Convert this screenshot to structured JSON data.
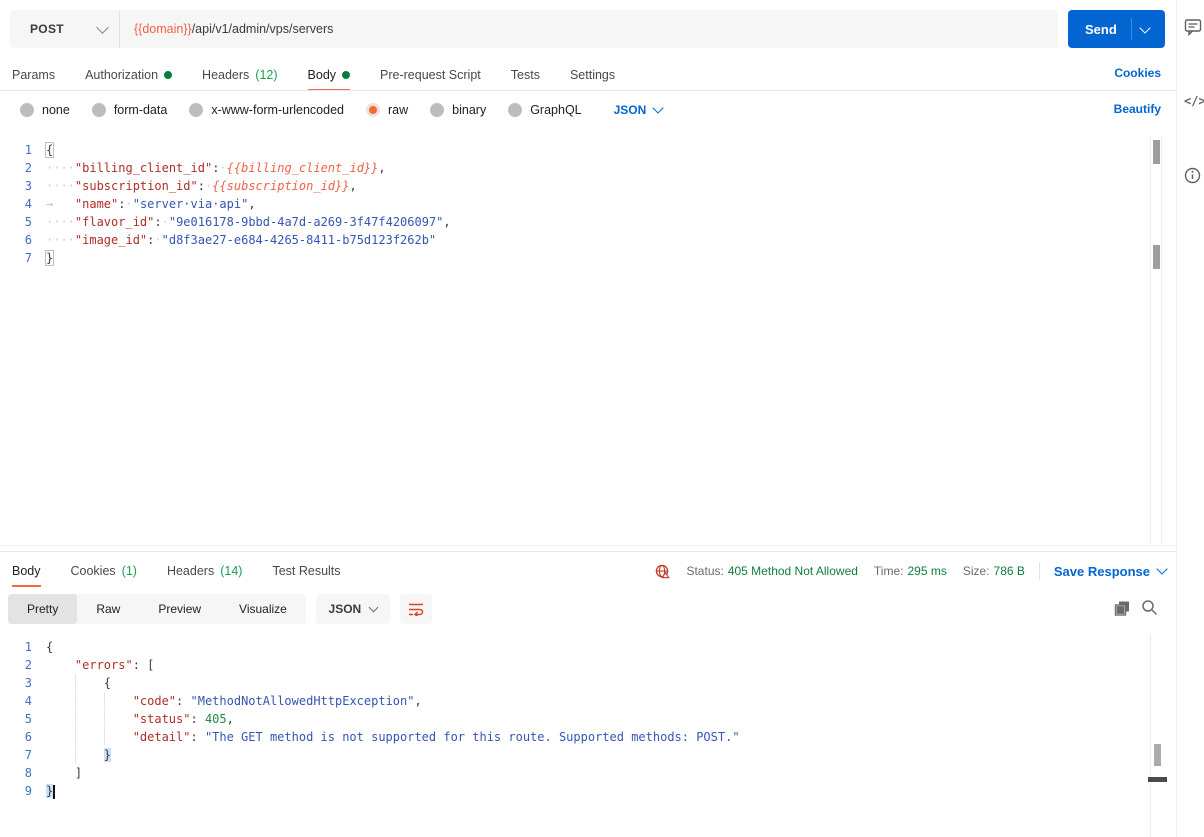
{
  "colors": {
    "accent_orange": "#F26B3A",
    "link_blue": "#0265D2",
    "success_green": "#0F7E3C",
    "error_red": "#C43C2E"
  },
  "request_bar": {
    "method": "POST",
    "url_variable": "{{domain}}",
    "url_path": "/api/v1/admin/vps/servers",
    "send_label": "Send"
  },
  "request_tabs": {
    "items": [
      {
        "label": "Params",
        "active": false
      },
      {
        "label": "Authorization",
        "dot": true,
        "active": false
      },
      {
        "label": "Headers",
        "badge": "(12)",
        "active": false
      },
      {
        "label": "Body",
        "dot": true,
        "active": true
      },
      {
        "label": "Pre-request Script",
        "active": false
      },
      {
        "label": "Tests",
        "active": false
      },
      {
        "label": "Settings",
        "active": false
      }
    ],
    "cookies_link": "Cookies"
  },
  "body_type_bar": {
    "options": [
      {
        "label": "none",
        "selected": false
      },
      {
        "label": "form-data",
        "selected": false
      },
      {
        "label": "x-www-form-urlencoded",
        "selected": false
      },
      {
        "label": "raw",
        "selected": true
      },
      {
        "label": "binary",
        "selected": false
      },
      {
        "label": "GraphQL",
        "selected": false
      }
    ],
    "language": "JSON",
    "beautify_label": "Beautify"
  },
  "request_editor": {
    "raw_text": [
      "{",
      "    \"billing_client_id\": {{billing_client_id}},",
      "    \"subscription_id\": {{subscription_id}},",
      "\t\"name\": \"server via api\",",
      "    \"flavor_id\": \"9e016178-9bbd-4a7d-a269-3f47f4206097\",",
      "    \"image_id\": \"d8f3ae27-e684-4265-8411-b75d123f262b\"",
      "}"
    ],
    "lines": [
      {
        "no": 1,
        "tokens": [
          {
            "t": "brace-box",
            "v": "{"
          }
        ]
      },
      {
        "no": 2,
        "tokens": [
          {
            "t": "ws",
            "v": "····"
          },
          {
            "t": "key",
            "v": "\"billing_client_id\""
          },
          {
            "t": "punc",
            "v": ":"
          },
          {
            "t": "ws",
            "v": "·"
          },
          {
            "t": "var",
            "v": "{{billing_client_id}}"
          },
          {
            "t": "punc",
            "v": ","
          }
        ]
      },
      {
        "no": 3,
        "tokens": [
          {
            "t": "ws",
            "v": "····"
          },
          {
            "t": "key",
            "v": "\"subscription_id\""
          },
          {
            "t": "punc",
            "v": ":"
          },
          {
            "t": "ws",
            "v": "·"
          },
          {
            "t": "var",
            "v": "{{subscription_id}}"
          },
          {
            "t": "punc",
            "v": ","
          }
        ]
      },
      {
        "no": 4,
        "tokens": [
          {
            "t": "tab",
            "v": "→"
          },
          {
            "t": "key",
            "v": "\"name\""
          },
          {
            "t": "punc",
            "v": ":"
          },
          {
            "t": "ws",
            "v": "·"
          },
          {
            "t": "str",
            "v": "\"server·via·api\""
          },
          {
            "t": "punc",
            "v": ","
          }
        ]
      },
      {
        "no": 5,
        "tokens": [
          {
            "t": "ws",
            "v": "····"
          },
          {
            "t": "key",
            "v": "\"flavor_id\""
          },
          {
            "t": "punc",
            "v": ":"
          },
          {
            "t": "ws",
            "v": "·"
          },
          {
            "t": "str",
            "v": "\"9e016178-9bbd-4a7d-a269-3f47f4206097\""
          },
          {
            "t": "punc",
            "v": ","
          }
        ]
      },
      {
        "no": 6,
        "tokens": [
          {
            "t": "ws",
            "v": "····"
          },
          {
            "t": "key",
            "v": "\"image_id\""
          },
          {
            "t": "punc",
            "v": ":"
          },
          {
            "t": "ws",
            "v": "·"
          },
          {
            "t": "str",
            "v": "\"d8f3ae27-e684-4265-8411-b75d123f262b\""
          }
        ]
      },
      {
        "no": 7,
        "tokens": [
          {
            "t": "brace-box",
            "v": "}"
          }
        ]
      }
    ]
  },
  "response": {
    "tabs": [
      {
        "label": "Body",
        "active": true
      },
      {
        "label": "Cookies",
        "badge": "(1)",
        "active": false
      },
      {
        "label": "Headers",
        "badge": "(14)",
        "active": false
      },
      {
        "label": "Test Results",
        "active": false
      }
    ],
    "status_label": "Status:",
    "status_value": "405 Method Not Allowed",
    "time_label": "Time:",
    "time_value": "295 ms",
    "size_label": "Size:",
    "size_value": "786 B",
    "save_label": "Save Response",
    "view_tabs": [
      {
        "label": "Pretty",
        "selected": true
      },
      {
        "label": "Raw",
        "selected": false
      },
      {
        "label": "Preview",
        "selected": false
      },
      {
        "label": "Visualize",
        "selected": false
      }
    ],
    "language": "JSON",
    "editor": {
      "raw_text": [
        "{",
        "    \"errors\": [",
        "        {",
        "            \"code\": \"MethodNotAllowedHttpException\",",
        "            \"status\": 405,",
        "            \"detail\": \"The GET method is not supported for this route. Supported methods: POST.\"",
        "        }",
        "    ]",
        "}"
      ],
      "lines": [
        {
          "no": 1,
          "tokens": [
            {
              "t": "punc",
              "v": "{"
            }
          ]
        },
        {
          "no": 2,
          "tokens": [
            {
              "t": "punc",
              "v": "    "
            },
            {
              "t": "key",
              "v": "\"errors\""
            },
            {
              "t": "punc",
              "v": ": ["
            }
          ]
        },
        {
          "no": 3,
          "tokens": [
            {
              "t": "punc",
              "v": "    "
            },
            {
              "t": "guide",
              "v": ""
            },
            {
              "t": "punc",
              "v": "{"
            }
          ]
        },
        {
          "no": 4,
          "tokens": [
            {
              "t": "punc",
              "v": "    "
            },
            {
              "t": "guide",
              "v": ""
            },
            {
              "t": "guide",
              "v": ""
            },
            {
              "t": "key",
              "v": "\"code\""
            },
            {
              "t": "punc",
              "v": ": "
            },
            {
              "t": "str",
              "v": "\"MethodNotAllowedHttpException\""
            },
            {
              "t": "punc",
              "v": ","
            }
          ]
        },
        {
          "no": 5,
          "tokens": [
            {
              "t": "punc",
              "v": "    "
            },
            {
              "t": "guide",
              "v": ""
            },
            {
              "t": "guide",
              "v": ""
            },
            {
              "t": "key",
              "v": "\"status\""
            },
            {
              "t": "punc",
              "v": ": "
            },
            {
              "t": "num",
              "v": "405"
            },
            {
              "t": "punc",
              "v": ","
            }
          ]
        },
        {
          "no": 6,
          "tokens": [
            {
              "t": "punc",
              "v": "    "
            },
            {
              "t": "guide",
              "v": ""
            },
            {
              "t": "guide",
              "v": ""
            },
            {
              "t": "key",
              "v": "\"detail\""
            },
            {
              "t": "punc",
              "v": ": "
            },
            {
              "t": "str",
              "v": "\"The GET method is not supported for this route. Supported methods: POST.\""
            }
          ]
        },
        {
          "no": 7,
          "tokens": [
            {
              "t": "punc",
              "v": "    "
            },
            {
              "t": "guide",
              "v": ""
            },
            {
              "t": "brace-hl",
              "v": "}"
            }
          ]
        },
        {
          "no": 8,
          "tokens": [
            {
              "t": "punc",
              "v": "    "
            },
            {
              "t": "punc",
              "v": "]"
            }
          ]
        },
        {
          "no": 9,
          "tokens": [
            {
              "t": "brace-hl",
              "v": "}"
            },
            {
              "t": "cursor",
              "v": ""
            }
          ]
        }
      ]
    }
  },
  "right_rail": {
    "icons": [
      "comment-icon",
      "code-snippet-icon",
      "info-icon"
    ],
    "code_glyph": "</>"
  }
}
